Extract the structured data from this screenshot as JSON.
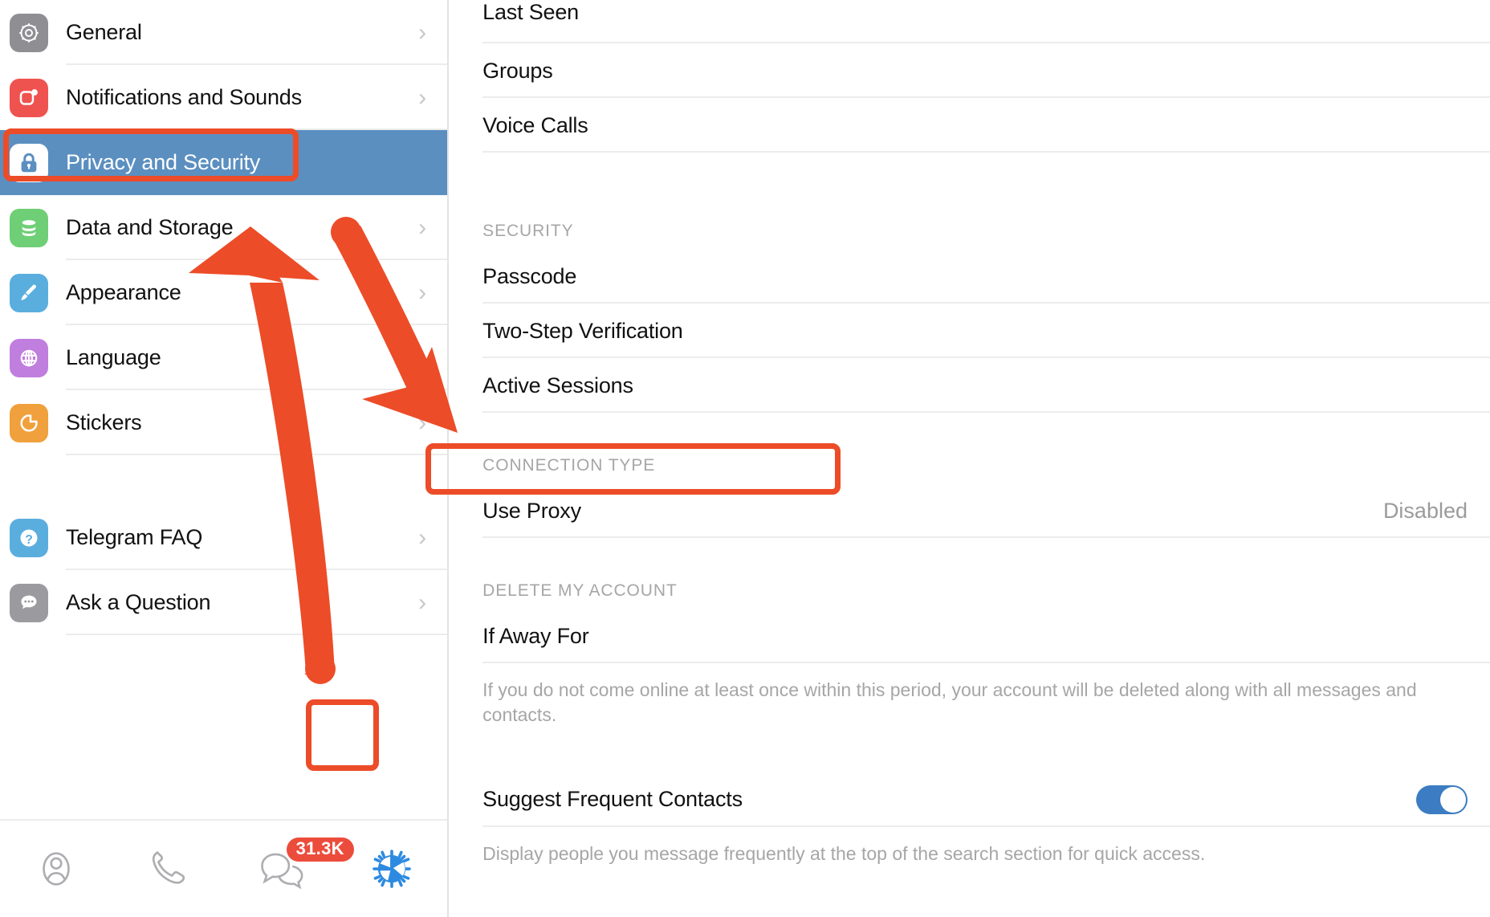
{
  "accent": "#ec4c28",
  "selected_bg": "#5b8fc0",
  "sidebar": {
    "items": [
      {
        "label": "General",
        "icon": "gear-icon",
        "color": "#8e8e93",
        "chevron": "›",
        "selected": false
      },
      {
        "label": "Notifications and Sounds",
        "icon": "bell-notification-icon",
        "color": "#ef5350",
        "chevron": "›",
        "selected": false
      },
      {
        "label": "Privacy and Security",
        "icon": "lock-icon",
        "color": "#ffffff",
        "chevron": "",
        "selected": true
      },
      {
        "label": "Data and Storage",
        "icon": "database-icon",
        "color": "#6fcf76",
        "chevron": "›",
        "selected": false
      },
      {
        "label": "Appearance",
        "icon": "paintbrush-icon",
        "color": "#5aaede",
        "chevron": "›",
        "selected": false
      },
      {
        "label": "Language",
        "icon": "globe-icon",
        "color": "#c07ede",
        "chevron": "›",
        "selected": false
      },
      {
        "label": "Stickers",
        "icon": "sticker-icon",
        "color": "#f0a03c",
        "chevron": "›",
        "selected": false
      }
    ],
    "help_items": [
      {
        "label": "Telegram FAQ",
        "icon": "question-mark-icon",
        "color": "#5aaede",
        "chevron": "›"
      },
      {
        "label": "Ask a Question",
        "icon": "chat-bubble-icon",
        "color": "#9a9a9f",
        "chevron": "›"
      }
    ]
  },
  "tabbar": {
    "tabs": [
      {
        "name": "contacts",
        "icon": "person-icon",
        "badge": ""
      },
      {
        "name": "calls",
        "icon": "phone-icon",
        "badge": ""
      },
      {
        "name": "chats",
        "icon": "chats-icon",
        "badge": "31.3K"
      },
      {
        "name": "settings",
        "icon": "settings-gear-icon",
        "badge": ""
      }
    ]
  },
  "content": {
    "top_rows": [
      {
        "title": "Last Seen",
        "value": ""
      },
      {
        "title": "Groups",
        "value": ""
      },
      {
        "title": "Voice Calls",
        "value": ""
      }
    ],
    "security": {
      "header": "SECURITY",
      "rows": [
        {
          "title": "Passcode",
          "value": ""
        },
        {
          "title": "Two-Step Verification",
          "value": ""
        },
        {
          "title": "Active Sessions",
          "value": ""
        }
      ]
    },
    "connection": {
      "header": "CONNECTION TYPE",
      "rows": [
        {
          "title": "Use Proxy",
          "value": "Disabled"
        }
      ]
    },
    "delete_account": {
      "header": "DELETE MY ACCOUNT",
      "rows": [
        {
          "title": "If Away For",
          "value": ""
        }
      ],
      "note": "If you do not come online at least once within this period, your account will be deleted along with all messages and contacts."
    },
    "suggest": {
      "title": "Suggest Frequent Contacts",
      "toggle_on": true,
      "note": "Display people you message frequently at the top of the search section for quick access."
    }
  },
  "annotations": {
    "highlight_privacy": "Privacy and Security",
    "highlight_use_proxy": "Use Proxy",
    "highlight_settings_tab": "Settings tab",
    "arrow_up": "arrow pointing up to Privacy and Security",
    "arrow_down": "arrow pointing down-right to Use Proxy"
  }
}
